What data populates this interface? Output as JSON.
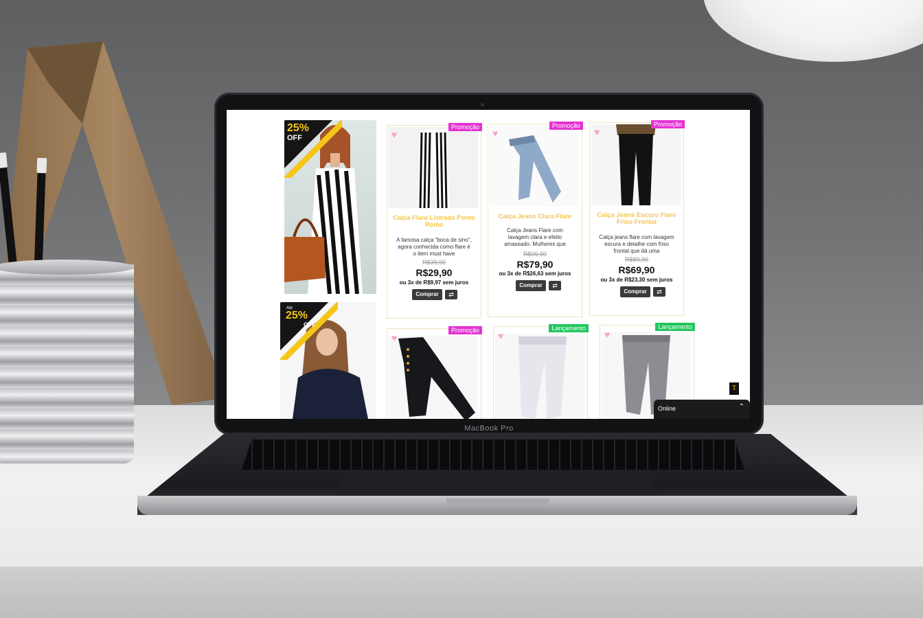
{
  "device": {
    "brand": "MacBook Pro"
  },
  "banners": [
    {
      "percent": "25%",
      "off_label": "OFF",
      "prefix": ""
    },
    {
      "percent": "25%",
      "off_label": "OFF",
      "prefix": "Até"
    }
  ],
  "products": [
    {
      "name": "Calça Flare Listrada Ponto Roma",
      "badge": "Promoção",
      "description": "A famosa calça \"boca de sino\", agora conhecida como flare é o item must have",
      "old_price": "R$39,90",
      "price": "R$29,90",
      "installments": "ou 3x de R$9,97 sem juros",
      "buy_label": "Comprar"
    },
    {
      "name": "Calça Jeans Clara Flare",
      "badge": "Promoção",
      "description": "Calça Jeans Flare com lavagem clara e efeito amassado. Mulheres que",
      "old_price": "R$99,90",
      "price": "R$79,90",
      "installments": "ou 3x de R$26,63 sem juros",
      "buy_label": "Comprar"
    },
    {
      "name": "Calça Jeans Escuro Flare Friso Frontal",
      "badge": "Promoção",
      "description": "Calça jeans flare com lavagem escura e detalhe com friso frontal que dá uma",
      "old_price": "R$89,90",
      "price": "R$69,90",
      "installments": "ou 3x de R$23,30 sem juros",
      "buy_label": "Comprar"
    }
  ],
  "products_row2": [
    {
      "badge": "Promoção"
    },
    {
      "badge": "Lançamento"
    },
    {
      "badge": "Lançamento"
    }
  ],
  "chat": {
    "status": "Online"
  },
  "store_logo": "T",
  "colors": {
    "promo": "#e432d3",
    "launch": "#22c55e",
    "product_title": "#f3c54e",
    "offer_yellow": "#f5c518"
  }
}
